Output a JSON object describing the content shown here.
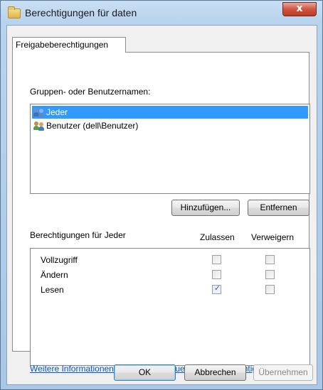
{
  "window": {
    "title": "Berechtigungen für daten",
    "close_symbol": "x"
  },
  "tab": {
    "label": "Freigabeberechtigungen"
  },
  "groups": {
    "label": "Gruppen- oder Benutzernamen:",
    "items": [
      {
        "label": "Jeder",
        "selected": true,
        "icon": "users-icon"
      },
      {
        "label": "Benutzer (dell\\Benutzer)",
        "selected": false,
        "icon": "users-icon"
      }
    ]
  },
  "buttons": {
    "add": "Hinzufügen...",
    "remove": "Entfernen",
    "ok": "OK",
    "cancel": "Abbrechen",
    "apply": "Übernehmen"
  },
  "permissions": {
    "heading": "Berechtigungen für Jeder",
    "col_allow": "Zulassen",
    "col_deny": "Verweigern",
    "rows": [
      {
        "label": "Vollzugriff",
        "allow": false,
        "deny": false
      },
      {
        "label": "Ändern",
        "allow": false,
        "deny": false
      },
      {
        "label": "Lesen",
        "allow": true,
        "deny": false
      }
    ]
  },
  "link": {
    "label": "Weitere Informationen über Zugriffssteuerung und Berechtigungen"
  },
  "colors": {
    "selection": "#3399ff",
    "link": "#0b5ac8",
    "close_button": "#c13a24"
  }
}
